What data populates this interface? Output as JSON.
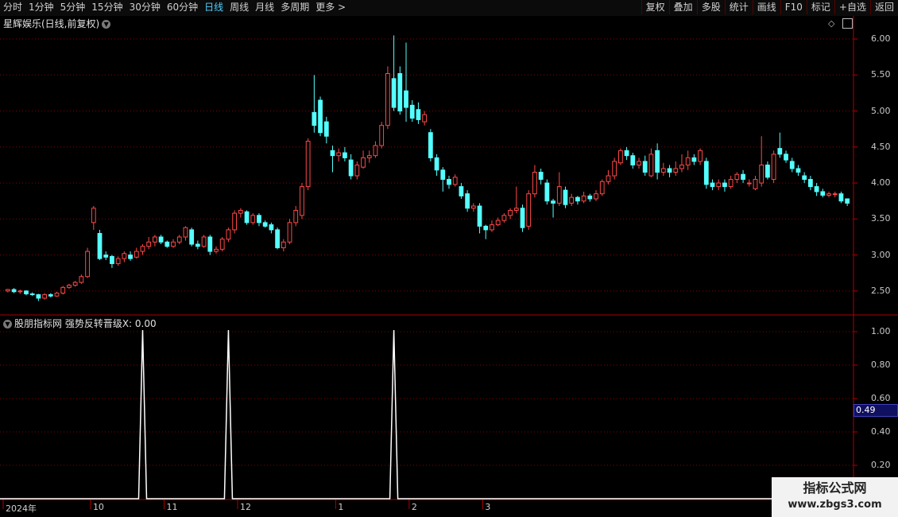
{
  "toolbar": {
    "periods": [
      "分时",
      "1分钟",
      "5分钟",
      "15分钟",
      "30分钟",
      "60分钟",
      "日线",
      "周线",
      "月线",
      "多周期",
      "更多 >"
    ],
    "active_period": "日线",
    "buttons": [
      "复权",
      "叠加",
      "多股",
      "统计",
      "画线",
      "F10",
      "标记",
      "+自选",
      "返回"
    ]
  },
  "stock": {
    "title": "星辉娱乐(日线,前复权)"
  },
  "indicator": {
    "title": "股朋指标网 强势反转晋级X: 0.00",
    "current_value": "0.49"
  },
  "price_axis": [
    "6.00",
    "5.50",
    "5.00",
    "4.50",
    "4.00",
    "3.50",
    "3.00",
    "2.50"
  ],
  "indicator_axis": [
    "1.00",
    "0.80",
    "0.60",
    "0.40",
    "0.20"
  ],
  "date_axis": [
    "2024年",
    "10",
    "11",
    "12",
    "1",
    "2",
    "3"
  ],
  "watermark": {
    "title": "指标公式网",
    "url": "www.zbgs3.com"
  },
  "colors": {
    "up": "#ff4848",
    "down": "#54ffff",
    "grid": "#8a0000",
    "indicator_line": "#ffffff",
    "active_tab": "#4fd0ff"
  },
  "chart_data": {
    "type": "candlestick",
    "ylim": [
      2.2,
      6.1
    ],
    "candles": [
      [
        2.5,
        2.52,
        2.48,
        2.53
      ],
      [
        2.52,
        2.49,
        2.47,
        2.54
      ],
      [
        2.49,
        2.5,
        2.46,
        2.52
      ],
      [
        2.5,
        2.46,
        2.44,
        2.51
      ],
      [
        2.46,
        2.45,
        2.43,
        2.48
      ],
      [
        2.45,
        2.4,
        2.36,
        2.46
      ],
      [
        2.4,
        2.45,
        2.38,
        2.47
      ],
      [
        2.45,
        2.43,
        2.41,
        2.47
      ],
      [
        2.43,
        2.47,
        2.42,
        2.49
      ],
      [
        2.47,
        2.55,
        2.45,
        2.57
      ],
      [
        2.55,
        2.58,
        2.53,
        2.6
      ],
      [
        2.58,
        2.62,
        2.56,
        2.64
      ],
      [
        2.62,
        2.7,
        2.6,
        2.73
      ],
      [
        2.7,
        3.05,
        2.68,
        3.1
      ],
      [
        3.45,
        3.65,
        3.35,
        3.68
      ],
      [
        3.3,
        2.95,
        2.93,
        3.35
      ],
      [
        3.0,
        2.97,
        2.93,
        3.05
      ],
      [
        2.98,
        2.88,
        2.82,
        3.0
      ],
      [
        2.88,
        2.95,
        2.85,
        2.98
      ],
      [
        2.95,
        3.02,
        2.9,
        3.05
      ],
      [
        3.0,
        2.95,
        2.92,
        3.05
      ],
      [
        2.97,
        3.05,
        2.95,
        3.1
      ],
      [
        3.05,
        3.12,
        3.0,
        3.15
      ],
      [
        3.12,
        3.18,
        3.08,
        3.25
      ],
      [
        3.18,
        3.25,
        3.12,
        3.28
      ],
      [
        3.25,
        3.18,
        3.15,
        3.28
      ],
      [
        3.18,
        3.12,
        3.1,
        3.2
      ],
      [
        3.12,
        3.18,
        3.1,
        3.22
      ],
      [
        3.18,
        3.25,
        3.15,
        3.28
      ],
      [
        3.25,
        3.38,
        3.2,
        3.4
      ],
      [
        3.35,
        3.15,
        3.12,
        3.38
      ],
      [
        3.15,
        3.12,
        3.08,
        3.2
      ],
      [
        3.12,
        3.25,
        3.1,
        3.28
      ],
      [
        3.25,
        3.05,
        3.0,
        3.28
      ],
      [
        3.05,
        3.08,
        3.02,
        3.12
      ],
      [
        3.08,
        3.22,
        3.05,
        3.25
      ],
      [
        3.22,
        3.35,
        3.18,
        3.38
      ],
      [
        3.35,
        3.58,
        3.3,
        3.62
      ],
      [
        3.58,
        3.62,
        3.52,
        3.65
      ],
      [
        3.6,
        3.45,
        3.42,
        3.62
      ],
      [
        3.45,
        3.55,
        3.42,
        3.58
      ],
      [
        3.55,
        3.45,
        3.4,
        3.58
      ],
      [
        3.45,
        3.4,
        3.38,
        3.48
      ],
      [
        3.42,
        3.35,
        3.3,
        3.45
      ],
      [
        3.35,
        3.1,
        3.08,
        3.38
      ],
      [
        3.1,
        3.18,
        3.05,
        3.22
      ],
      [
        3.18,
        3.45,
        3.15,
        3.5
      ],
      [
        3.45,
        3.62,
        3.4,
        3.68
      ],
      [
        3.55,
        3.95,
        3.5,
        4.0
      ],
      [
        3.95,
        4.58,
        3.9,
        4.62
      ],
      [
        4.98,
        4.8,
        4.7,
        5.5
      ],
      [
        5.15,
        4.7,
        4.65,
        5.2
      ],
      [
        4.85,
        4.65,
        4.55,
        4.92
      ],
      [
        4.45,
        4.38,
        4.15,
        4.52
      ],
      [
        4.38,
        4.42,
        4.3,
        4.48
      ],
      [
        4.42,
        4.35,
        4.3,
        4.5
      ],
      [
        4.32,
        4.1,
        4.05,
        4.4
      ],
      [
        4.1,
        4.25,
        4.05,
        4.3
      ],
      [
        4.22,
        4.35,
        4.2,
        4.45
      ],
      [
        4.35,
        4.38,
        4.28,
        4.45
      ],
      [
        4.38,
        4.52,
        4.35,
        4.58
      ],
      [
        4.52,
        4.8,
        4.48,
        4.85
      ],
      [
        4.8,
        5.52,
        4.75,
        5.62
      ],
      [
        5.45,
        5.05,
        5.0,
        6.05
      ],
      [
        5.52,
        5.0,
        4.95,
        5.62
      ],
      [
        5.28,
        5.05,
        4.85,
        5.95
      ],
      [
        5.08,
        4.9,
        4.85,
        5.15
      ],
      [
        5.02,
        4.88,
        4.82,
        5.12
      ],
      [
        4.85,
        4.95,
        4.8,
        5.0
      ],
      [
        4.7,
        4.35,
        4.3,
        4.75
      ],
      [
        4.35,
        4.18,
        4.1,
        4.4
      ],
      [
        4.18,
        4.05,
        3.88,
        4.22
      ],
      [
        4.05,
        3.98,
        3.92,
        4.1
      ],
      [
        3.98,
        4.08,
        3.95,
        4.12
      ],
      [
        3.95,
        3.82,
        3.78,
        4.0
      ],
      [
        3.85,
        3.65,
        3.6,
        3.9
      ],
      [
        3.65,
        3.68,
        3.6,
        3.72
      ],
      [
        3.68,
        3.4,
        3.3,
        3.72
      ],
      [
        3.4,
        3.35,
        3.22,
        3.42
      ],
      [
        3.35,
        3.42,
        3.32,
        3.48
      ],
      [
        3.42,
        3.48,
        3.4,
        3.52
      ],
      [
        3.48,
        3.55,
        3.45,
        3.58
      ],
      [
        3.55,
        3.62,
        3.5,
        3.65
      ],
      [
        3.62,
        3.65,
        3.58,
        3.95
      ],
      [
        3.65,
        3.38,
        3.32,
        3.7
      ],
      [
        3.4,
        3.85,
        3.35,
        3.9
      ],
      [
        3.85,
        4.15,
        3.8,
        4.25
      ],
      [
        4.15,
        4.05,
        3.98,
        4.2
      ],
      [
        4.0,
        3.75,
        3.7,
        4.05
      ],
      [
        3.75,
        3.72,
        3.52,
        3.78
      ],
      [
        3.72,
        3.95,
        3.68,
        4.15
      ],
      [
        3.9,
        3.7,
        3.65,
        3.95
      ],
      [
        3.72,
        3.8,
        3.68,
        3.85
      ],
      [
        3.8,
        3.75,
        3.7,
        3.82
      ],
      [
        3.75,
        3.82,
        3.72,
        3.88
      ],
      [
        3.82,
        3.78,
        3.74,
        3.85
      ],
      [
        3.78,
        3.85,
        3.75,
        3.9
      ],
      [
        3.85,
        4.02,
        3.82,
        4.05
      ],
      [
        4.02,
        4.1,
        3.98,
        4.18
      ],
      [
        4.1,
        4.3,
        4.05,
        4.35
      ],
      [
        4.28,
        4.45,
        4.25,
        4.48
      ],
      [
        4.45,
        4.38,
        4.32,
        4.5
      ],
      [
        4.38,
        4.25,
        4.2,
        4.42
      ],
      [
        4.25,
        4.3,
        4.2,
        4.35
      ],
      [
        4.3,
        4.15,
        4.1,
        4.38
      ],
      [
        4.1,
        4.4,
        4.08,
        4.48
      ],
      [
        4.45,
        4.15,
        4.05,
        4.55
      ],
      [
        4.15,
        4.2,
        4.1,
        4.28
      ],
      [
        4.2,
        4.15,
        4.08,
        4.25
      ],
      [
        4.15,
        4.2,
        4.1,
        4.3
      ],
      [
        4.2,
        4.25,
        4.15,
        4.4
      ],
      [
        4.25,
        4.35,
        4.18,
        4.45
      ],
      [
        4.35,
        4.3,
        4.25,
        4.4
      ],
      [
        4.3,
        4.45,
        4.25,
        4.48
      ],
      [
        4.3,
        3.98,
        3.92,
        4.35
      ],
      [
        4.0,
        3.95,
        3.9,
        4.05
      ],
      [
        3.95,
        4.0,
        3.9,
        4.05
      ],
      [
        4.0,
        3.95,
        3.88,
        4.05
      ],
      [
        3.95,
        4.05,
        3.92,
        4.1
      ],
      [
        4.05,
        4.12,
        4.0,
        4.15
      ],
      [
        4.12,
        4.05,
        4.0,
        4.18
      ],
      [
        4.0,
        4.0,
        3.95,
        4.05
      ],
      [
        3.92,
        4.05,
        3.9,
        4.1
      ],
      [
        4.0,
        4.25,
        3.95,
        4.65
      ],
      [
        4.25,
        4.08,
        4.05,
        4.3
      ],
      [
        4.05,
        4.4,
        4.0,
        4.45
      ],
      [
        4.48,
        4.4,
        4.35,
        4.7
      ],
      [
        4.4,
        4.32,
        4.28,
        4.45
      ],
      [
        4.3,
        4.2,
        4.15,
        4.35
      ],
      [
        4.2,
        4.15,
        4.1,
        4.25
      ],
      [
        4.1,
        4.05,
        4.0,
        4.15
      ],
      [
        4.05,
        3.95,
        3.9,
        4.1
      ],
      [
        3.95,
        3.88,
        3.82,
        4.0
      ],
      [
        3.88,
        3.83,
        3.8,
        3.92
      ],
      [
        3.83,
        3.85,
        3.8,
        3.88
      ],
      [
        3.85,
        3.85,
        3.8,
        3.88
      ],
      [
        3.85,
        3.75,
        3.72,
        3.88
      ],
      [
        3.78,
        3.72,
        3.68,
        3.78
      ]
    ],
    "indicator_spikes": [
      {
        "date_index": 22,
        "value": 1.0
      },
      {
        "date_index": 36,
        "value": 1.0
      },
      {
        "date_index": 63,
        "value": 1.0
      }
    ]
  }
}
